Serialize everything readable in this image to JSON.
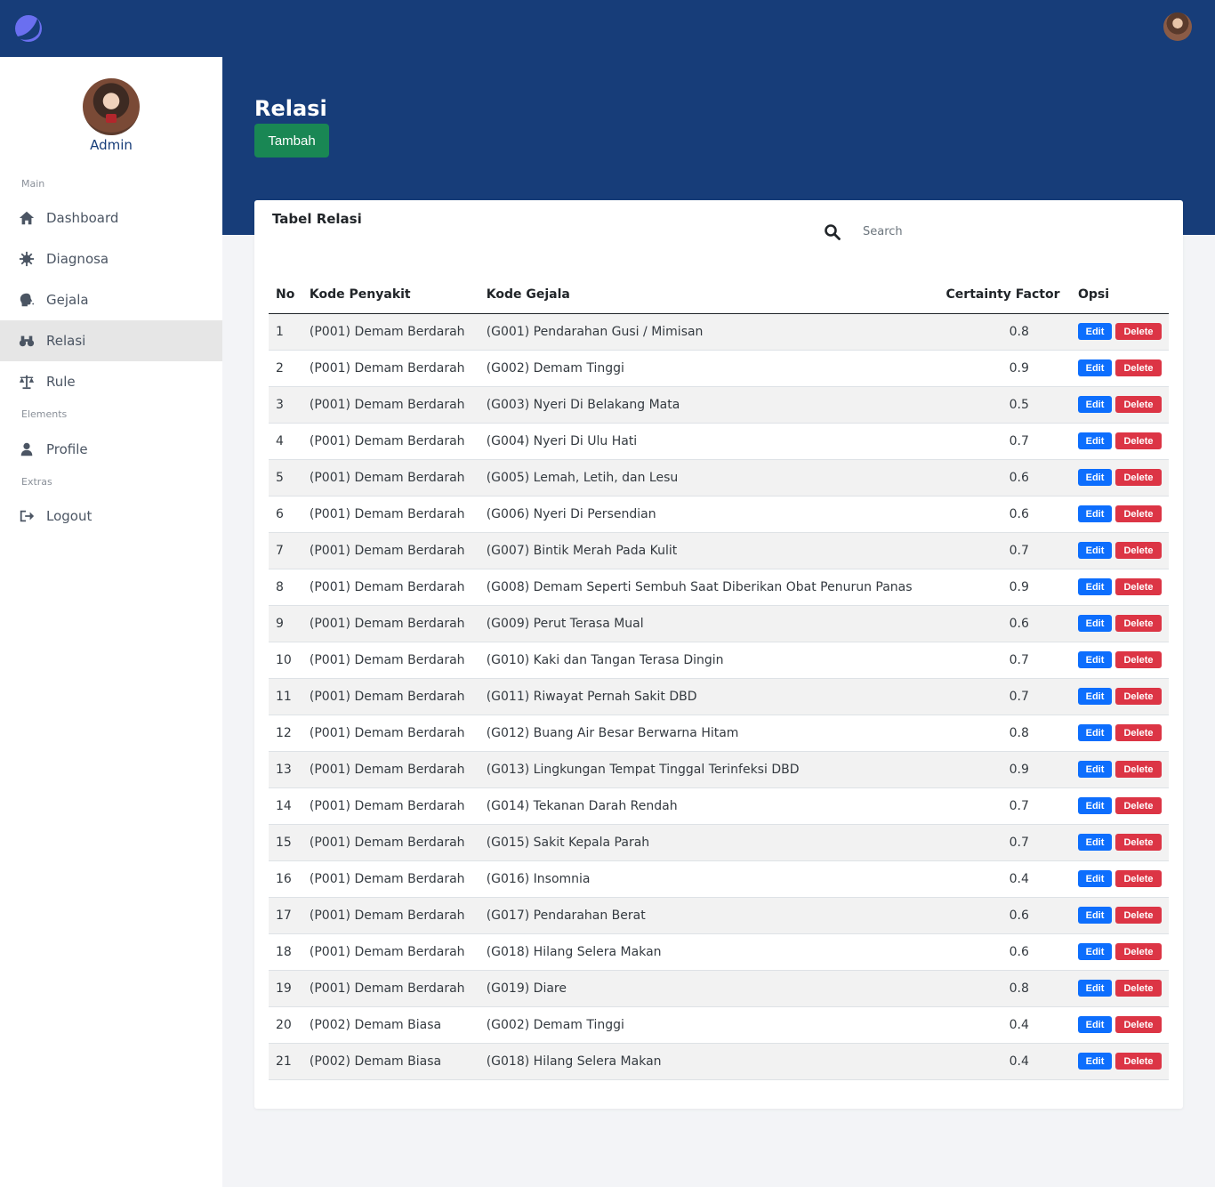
{
  "app": {
    "user_name": "Admin"
  },
  "sidebar": {
    "sections": [
      "Main",
      "Elements",
      "Extras"
    ],
    "items": [
      {
        "label": "Dashboard",
        "icon": "home-icon"
      },
      {
        "label": "Diagnosa",
        "icon": "virus-icon"
      },
      {
        "label": "Gejala",
        "icon": "head-icon"
      },
      {
        "label": "Relasi",
        "icon": "binoculars-icon",
        "active": true
      },
      {
        "label": "Rule",
        "icon": "balance-scale-icon"
      },
      {
        "label": "Profile",
        "icon": "user-icon"
      },
      {
        "label": "Logout",
        "icon": "sign-out-icon"
      }
    ]
  },
  "page": {
    "title": "Relasi",
    "add_label": "Tambah"
  },
  "card": {
    "title": "Tabel Relasi",
    "search_placeholder": "Search"
  },
  "table": {
    "headers": [
      "No",
      "Kode Penyakit",
      "Kode Gejala",
      "Certainty Factor",
      "Opsi"
    ],
    "edit_label": "Edit",
    "delete_label": "Delete",
    "rows": [
      [
        "1",
        "(P001) Demam Berdarah",
        "(G001) Pendarahan Gusi / Mimisan",
        "0.8"
      ],
      [
        "2",
        "(P001) Demam Berdarah",
        "(G002) Demam Tinggi",
        "0.9"
      ],
      [
        "3",
        "(P001) Demam Berdarah",
        "(G003) Nyeri Di Belakang Mata",
        "0.5"
      ],
      [
        "4",
        "(P001) Demam Berdarah",
        "(G004) Nyeri Di Ulu Hati",
        "0.7"
      ],
      [
        "5",
        "(P001) Demam Berdarah",
        "(G005) Lemah, Letih, dan Lesu",
        "0.6"
      ],
      [
        "6",
        "(P001) Demam Berdarah",
        "(G006) Nyeri Di Persendian",
        "0.6"
      ],
      [
        "7",
        "(P001) Demam Berdarah",
        "(G007) Bintik Merah Pada Kulit",
        "0.7"
      ],
      [
        "8",
        "(P001) Demam Berdarah",
        "(G008) Demam Seperti Sembuh Saat Diberikan Obat Penurun Panas",
        "0.9"
      ],
      [
        "9",
        "(P001) Demam Berdarah",
        "(G009) Perut Terasa Mual",
        "0.6"
      ],
      [
        "10",
        "(P001) Demam Berdarah",
        "(G010) Kaki dan Tangan Terasa Dingin",
        "0.7"
      ],
      [
        "11",
        "(P001) Demam Berdarah",
        "(G011) Riwayat Pernah Sakit DBD",
        "0.7"
      ],
      [
        "12",
        "(P001) Demam Berdarah",
        "(G012) Buang Air Besar Berwarna Hitam",
        "0.8"
      ],
      [
        "13",
        "(P001) Demam Berdarah",
        "(G013) Lingkungan Tempat Tinggal Terinfeksi DBD",
        "0.9"
      ],
      [
        "14",
        "(P001) Demam Berdarah",
        "(G014) Tekanan Darah Rendah",
        "0.7"
      ],
      [
        "15",
        "(P001) Demam Berdarah",
        "(G015) Sakit Kepala Parah",
        "0.7"
      ],
      [
        "16",
        "(P001) Demam Berdarah",
        "(G016) Insomnia",
        "0.4"
      ],
      [
        "17",
        "(P001) Demam Berdarah",
        "(G017) Pendarahan Berat",
        "0.6"
      ],
      [
        "18",
        "(P001) Demam Berdarah",
        "(G018) Hilang Selera Makan",
        "0.6"
      ],
      [
        "19",
        "(P001) Demam Berdarah",
        "(G019) Diare",
        "0.8"
      ],
      [
        "20",
        "(P002) Demam Biasa",
        "(G002) Demam Tinggi",
        "0.4"
      ],
      [
        "21",
        "(P002) Demam Biasa",
        "(G018) Hilang Selera Makan",
        "0.4"
      ]
    ]
  },
  "colors": {
    "primary": "#173d79",
    "success": "#198754",
    "edit": "#0d6efd",
    "delete": "#dc3545"
  }
}
